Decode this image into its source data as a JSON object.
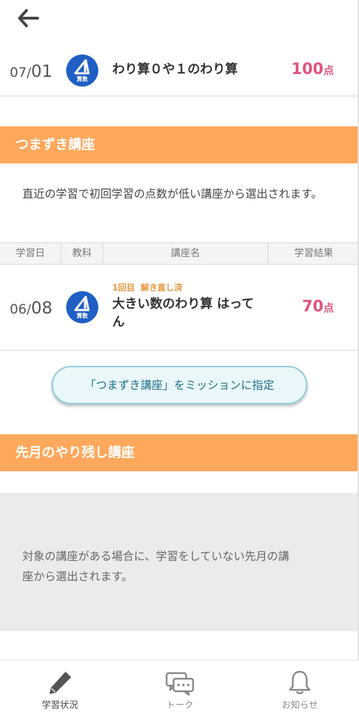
{
  "header": {
    "back_icon": "arrow-left-icon"
  },
  "recent_course": {
    "month": "07",
    "day": "01",
    "subject_label": "算数",
    "title": "わり算０や１のわり算",
    "score": "100",
    "score_unit": "点"
  },
  "stumble_section": {
    "title": "つまずき講座",
    "description": "直近の学習で初回学習の点数が低い講座から選出されます。",
    "table_headers": [
      "学習日",
      "教科",
      "講座名",
      "学習結果"
    ],
    "rows": [
      {
        "month": "06",
        "day": "08",
        "subject_label": "算数",
        "attempt": "1回目",
        "status": "解き直し済",
        "title_line1": "大きい数のわり算 はって",
        "title_line2": "ん",
        "score": "70",
        "score_unit": "点"
      }
    ],
    "mission_button": "「つまずき講座」をミッションに指定"
  },
  "leftover_section": {
    "title": "先月のやり残し講座",
    "empty_message_line1": "対象の講座がある場合に、学習をしていない先月の講",
    "empty_message_line2": "座から選出されます。"
  },
  "tabbar": {
    "tabs": [
      {
        "label": "学習状況",
        "icon": "pencil-icon",
        "active": true
      },
      {
        "label": "トーク",
        "icon": "chat-bubbles-icon",
        "active": false
      },
      {
        "label": "お知らせ",
        "icon": "bell-icon",
        "active": false
      }
    ]
  },
  "colors": {
    "accent_orange": "#ffa85c",
    "score_pink": "#e0527c",
    "subject_blue": "#1f5fc4",
    "attempt_orange": "#e8963c"
  }
}
